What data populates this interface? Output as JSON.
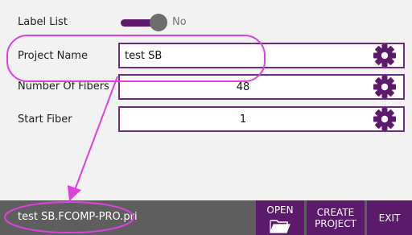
{
  "label_list": {
    "label": "Label List",
    "state": "No"
  },
  "fields": [
    {
      "label": "Project Name",
      "value": "test SB"
    },
    {
      "label": "Number Of Fibers",
      "value": "48"
    },
    {
      "label": "Start Fiber",
      "value": "1"
    }
  ],
  "footer": {
    "filename": "test SB.FCOMP-PRO.pri",
    "open_label": "OPEN",
    "create_label": "CREATE PROJECT",
    "exit_label": "EXIT"
  },
  "colors": {
    "accent": "#5c1a6b",
    "highlight": "#e040e0",
    "bar": "#5e5e5e"
  },
  "icons": [
    "gear-icon",
    "folder-icon"
  ]
}
